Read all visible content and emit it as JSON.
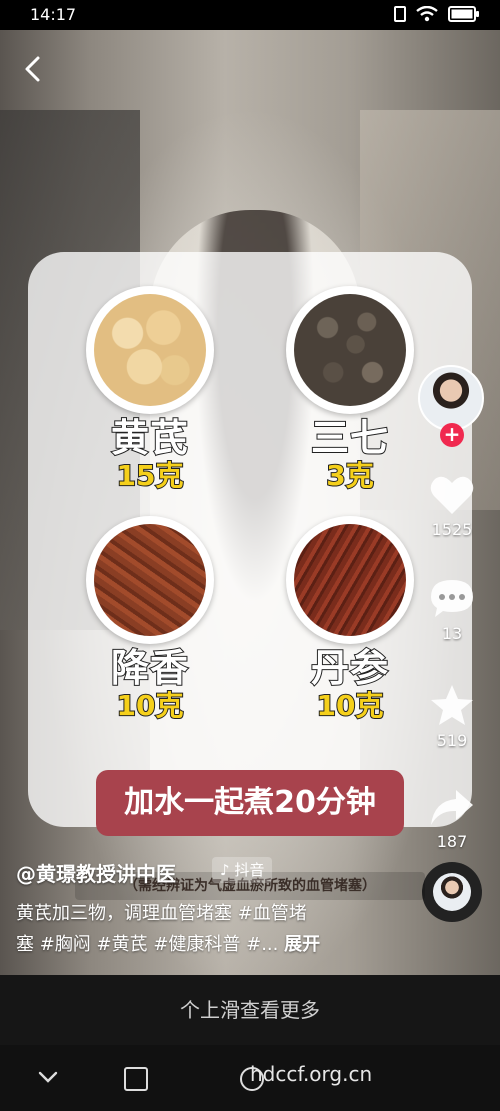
{
  "status_bar": {
    "time": "14:17"
  },
  "card": {
    "herbs": [
      {
        "name": "黄芪",
        "dose": "15克"
      },
      {
        "name": "三七",
        "dose": "3克"
      },
      {
        "name": "降香",
        "dose": "10克"
      },
      {
        "name": "丹参",
        "dose": "10克"
      }
    ],
    "banner": "加水一起煮20分钟"
  },
  "actions": {
    "like_count": "1525",
    "comment_count": "13",
    "favorite_count": "519",
    "share_count": "187",
    "follow_symbol": "+"
  },
  "caption": {
    "author": "@黄璟教授讲中医",
    "source_tag": "抖音",
    "description_line1": "黄芪加三物，调理血管堵塞 #血管堵",
    "description_line2": "塞 #胸闷 #黄芪 #健康科普 #...",
    "expand_label": "展开",
    "subtitle": "（需经辨证为气虚血瘀所致的血管堵塞）"
  },
  "swipe_hint": "个上滑查看更多",
  "watermark": "hdccf.org.cn",
  "icons": {
    "back": "chevron-left-icon",
    "like": "heart-icon",
    "comment": "speech-bubble-icon",
    "favorite": "star-icon",
    "share": "share-arrow-icon"
  }
}
